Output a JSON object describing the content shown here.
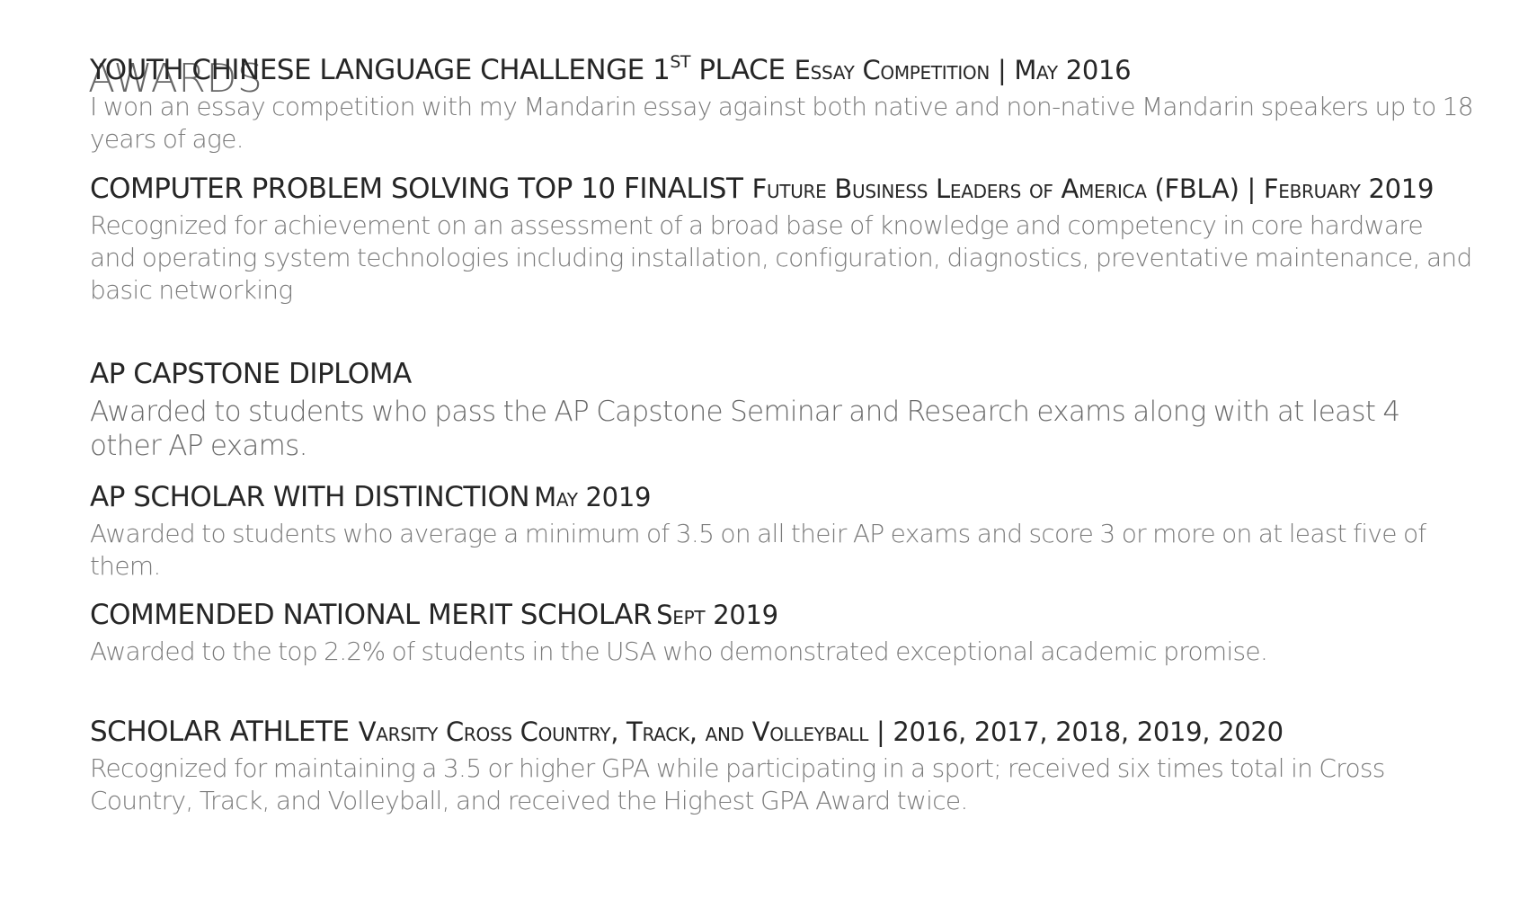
{
  "section": {
    "title": "AWARDS"
  },
  "awards": [
    {
      "title": "YOUTH CHINESE LANGUAGE CHALLENGE 1",
      "title_sup": "ST",
      "title_tail": " PLACE",
      "meta": "Essay Competition | May 2016",
      "description": "I won an essay competition with my Mandarin essay against both native and non-native Mandarin speakers up to 18 years of age."
    },
    {
      "title": "COMPUTER PROBLEM SOLVING TOP 10 FINALIST",
      "meta": "Future Business Leaders of America (FBLA) | February 2019",
      "description": "Recognized for achievement on an assessment of a broad base of knowledge and competency in core hardware and operating system technologies including installation, configuration, diagnostics, preventative maintenance, and basic networking"
    },
    {
      "title": "AP CAPSTONE DIPLOMA",
      "description": "Awarded to students who pass the AP Capstone Seminar and Research exams along with at least 4 other AP exams."
    },
    {
      "title": "AP SCHOLAR WITH DISTINCTION",
      "meta": "May 2019",
      "description": "Awarded to students who average a minimum of 3.5 on all their AP exams and score 3 or more on at least five of them."
    },
    {
      "title": "COMMENDED NATIONAL MERIT SCHOLAR",
      "meta": "Sept 2019",
      "description": "Awarded to the top 2.2% of students in the USA who demonstrated exceptional academic promise."
    },
    {
      "title": "SCHOLAR ATHLETE",
      "meta": "Varsity Cross Country, Track, and Volleyball | 2016, 2017, 2018, 2019, 2020",
      "description": "Recognized for maintaining a 3.5 or higher GPA while participating in a sport; received six times total in Cross Country, Track, and Volleyball, and received the Highest GPA Award twice."
    }
  ]
}
